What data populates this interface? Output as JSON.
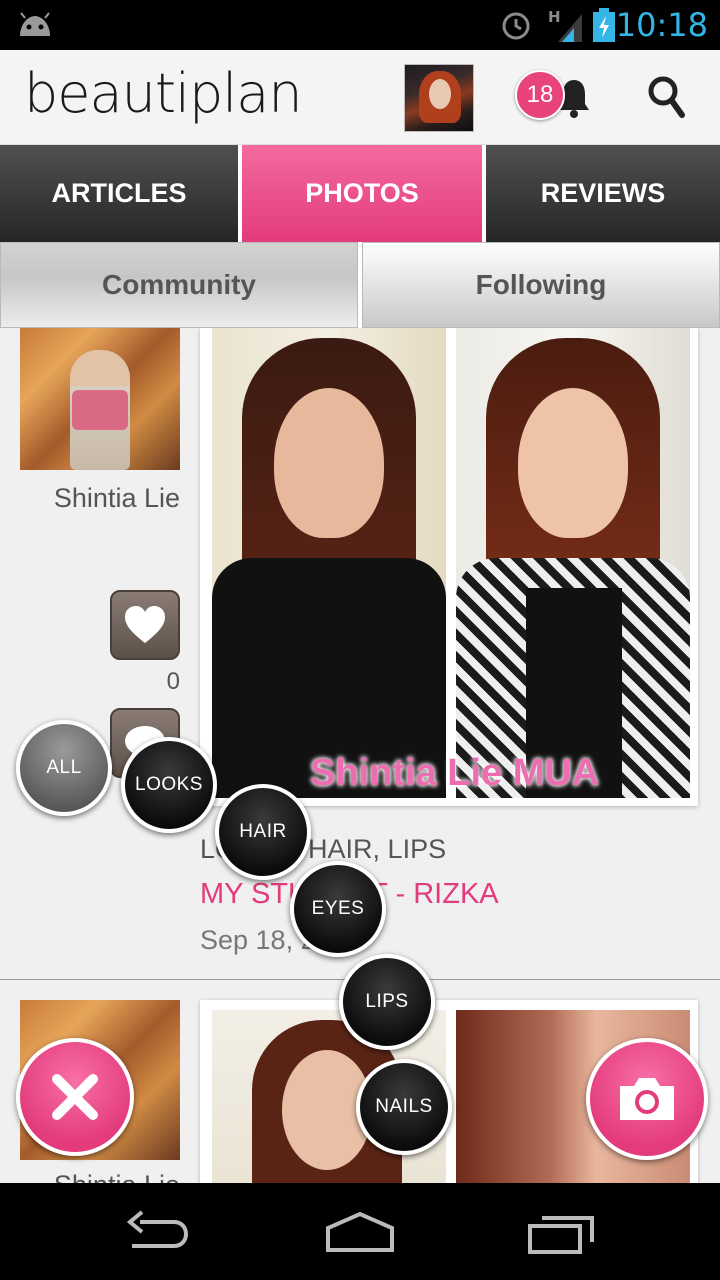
{
  "status_bar": {
    "time": "10:18",
    "network": "H",
    "icons": [
      "android-icon",
      "alarm-icon",
      "signal-icon",
      "battery-charging-icon"
    ],
    "clock_color": "#33b5e5"
  },
  "header": {
    "logo": "beautiplan",
    "notification_count": "18",
    "icons": [
      "user-avatar",
      "bell-icon",
      "search-icon"
    ]
  },
  "tabs": [
    {
      "label": "ARTICLES",
      "active": false
    },
    {
      "label": "PHOTOS",
      "active": true
    },
    {
      "label": "REVIEWS",
      "active": false
    }
  ],
  "subtabs": [
    {
      "label": "Community",
      "active": true
    },
    {
      "label": "Following",
      "active": false
    }
  ],
  "posts": [
    {
      "author": "Shintia Lie",
      "likes": "0",
      "photo_caption": "Shintia Lie MUA",
      "tags": "LOOKS, HAIR, LIPS",
      "title": "MY STUDENT - RIZKA",
      "date": "Sep 18, 2"
    },
    {
      "author": "Shintia Lie"
    }
  ],
  "category_menu": [
    "ALL",
    "LOOKS",
    "HAIR",
    "EYES",
    "LIPS",
    "NAILS"
  ],
  "fab": {
    "close_icon": "close-icon",
    "camera_icon": "camera-icon"
  },
  "colors": {
    "accent": "#e33b7c",
    "tab_dark": "#2e2e2e",
    "background": "#f0f0f0"
  },
  "navigation": [
    "back-icon",
    "home-icon",
    "recent-apps-icon"
  ]
}
